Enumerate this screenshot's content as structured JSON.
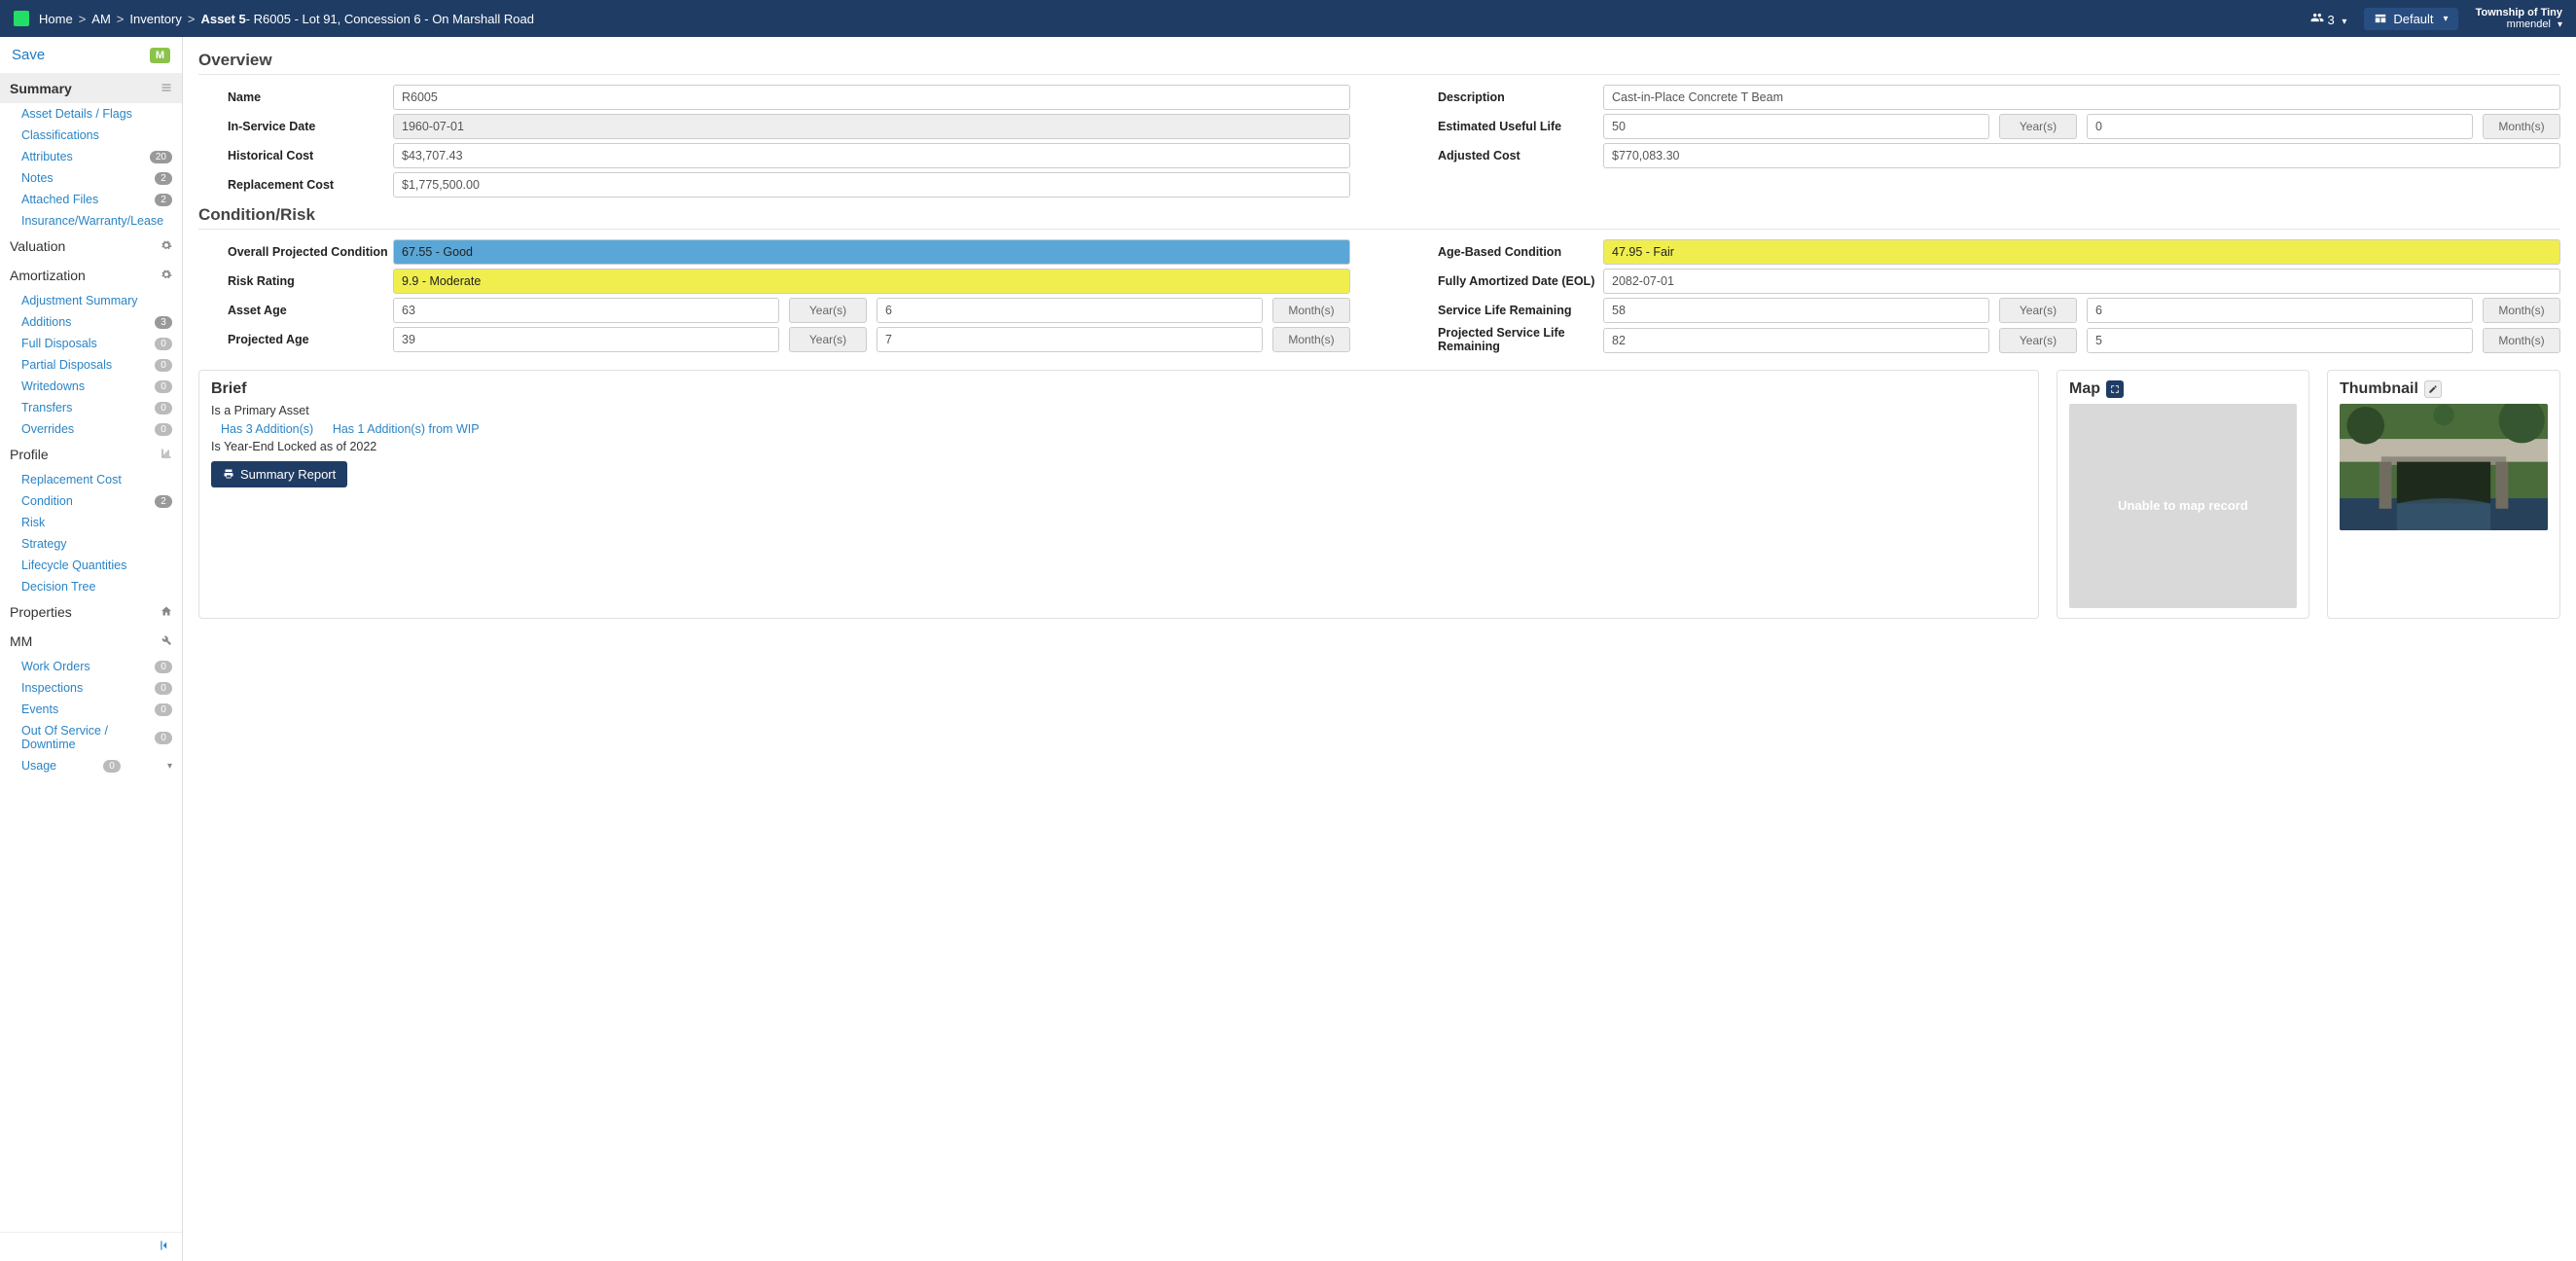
{
  "header": {
    "breadcrumbs": [
      "Home",
      "AM",
      "Inventory"
    ],
    "current_prefix": "Asset 5",
    "current_suffix": "- R6005 - Lot 91, Concession 6 - On Marshall Road",
    "users_badge": "3",
    "default_label": "Default",
    "tenant_name": "Township of Tiny",
    "tenant_user": "mmendel"
  },
  "save_label": "Save",
  "save_badge": "M",
  "sidebar": {
    "sections": [
      {
        "title": "Summary",
        "active": true,
        "icon": "list",
        "items": [
          {
            "label": "Asset Details / Flags"
          },
          {
            "label": "Classifications"
          },
          {
            "label": "Attributes",
            "badge": "20"
          },
          {
            "label": "Notes",
            "badge": "2"
          },
          {
            "label": "Attached Files",
            "badge": "2"
          },
          {
            "label": "Insurance/Warranty/Lease"
          }
        ]
      },
      {
        "title": "Valuation",
        "icon": "gear",
        "items": []
      },
      {
        "title": "Amortization",
        "icon": "gear",
        "items": [
          {
            "label": "Adjustment Summary"
          },
          {
            "label": "Additions",
            "badge": "3"
          },
          {
            "label": "Full Disposals",
            "badge": "0"
          },
          {
            "label": "Partial Disposals",
            "badge": "0"
          },
          {
            "label": "Writedowns",
            "badge": "0"
          },
          {
            "label": "Transfers",
            "badge": "0"
          },
          {
            "label": "Overrides",
            "badge": "0"
          }
        ]
      },
      {
        "title": "Profile",
        "icon": "chart",
        "items": [
          {
            "label": "Replacement Cost"
          },
          {
            "label": "Condition",
            "badge": "2"
          },
          {
            "label": "Risk"
          },
          {
            "label": "Strategy"
          },
          {
            "label": "Lifecycle Quantities"
          },
          {
            "label": "Decision Tree"
          }
        ]
      },
      {
        "title": "Properties",
        "icon": "home",
        "items": []
      },
      {
        "title": "MM",
        "icon": "wrench",
        "items": [
          {
            "label": "Work Orders",
            "badge": "0"
          },
          {
            "label": "Inspections",
            "badge": "0"
          },
          {
            "label": "Events",
            "badge": "0"
          },
          {
            "label": "Out Of Service / Downtime",
            "badge": "0"
          },
          {
            "label": "Usage",
            "badge": "0",
            "caret": true
          }
        ]
      }
    ]
  },
  "overview": {
    "title": "Overview",
    "name_label": "Name",
    "name": "R6005",
    "desc_label": "Description",
    "desc": "Cast-in-Place Concrete T Beam",
    "inservice_label": "In-Service Date",
    "inservice": "1960-07-01",
    "eul_label": "Estimated Useful Life",
    "eul_years": "50",
    "eul_months": "0",
    "hist_label": "Historical Cost",
    "hist": "$43,707.43",
    "adj_label": "Adjusted Cost",
    "adj": "$770,083.30",
    "repl_label": "Replacement Cost",
    "repl": "$1,775,500.00"
  },
  "cond": {
    "title": "Condition/Risk",
    "opc_label": "Overall Projected Condition",
    "opc": "67.55 - Good",
    "abc_label": "Age-Based Condition",
    "abc": "47.95 - Fair",
    "risk_label": "Risk Rating",
    "risk": "9.9 - Moderate",
    "eol_label": "Fully Amortized Date (EOL)",
    "eol": "2082-07-01",
    "age_label": "Asset Age",
    "age_y": "63",
    "age_m": "6",
    "slr_label": "Service Life Remaining",
    "slr_y": "58",
    "slr_m": "6",
    "proj_label": "Projected Age",
    "proj_y": "39",
    "proj_m": "7",
    "pslr_label": "Projected Service Life Remaining",
    "pslr_y": "82",
    "pslr_m": "5",
    "years_suffix": "Year(s)",
    "months_suffix": "Month(s)"
  },
  "brief": {
    "title": "Brief",
    "line1": "Is a Primary Asset",
    "link1": "Has 3 Addition(s)",
    "link2": "Has 1 Addition(s) from WIP",
    "line2": "Is Year-End Locked as of 2022",
    "report_btn": "Summary Report"
  },
  "map": {
    "title": "Map",
    "placeholder": "Unable to map record"
  },
  "thumb": {
    "title": "Thumbnail"
  }
}
